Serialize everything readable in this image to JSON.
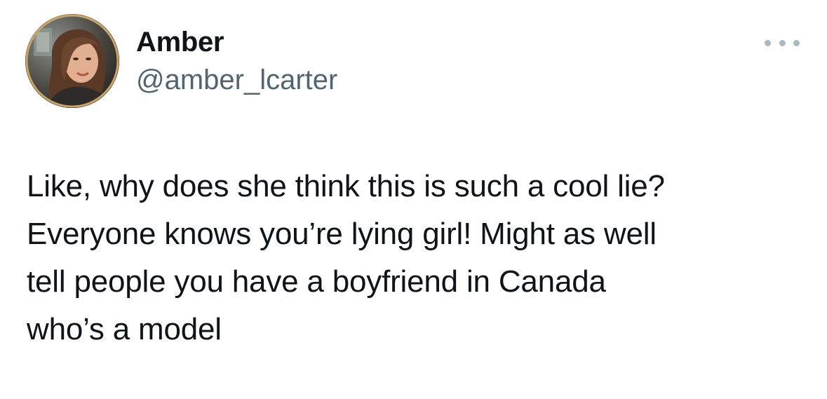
{
  "author": {
    "display_name": "Amber",
    "handle": "@amber_lcarter",
    "avatar_icon": "profile-photo"
  },
  "menu": {
    "icon": "more-options-icon"
  },
  "tweet": {
    "lines": [
      "Like, why does she think this is such a cool lie?",
      "Everyone knows you’re lying girl! Might as well",
      "tell people you have a boyfriend in Canada",
      "who’s a model"
    ]
  },
  "colors": {
    "text": "#0f1419",
    "secondary": "#536471",
    "menu_dots": "#aab8c2",
    "avatar_ring": "#c9a46a"
  }
}
